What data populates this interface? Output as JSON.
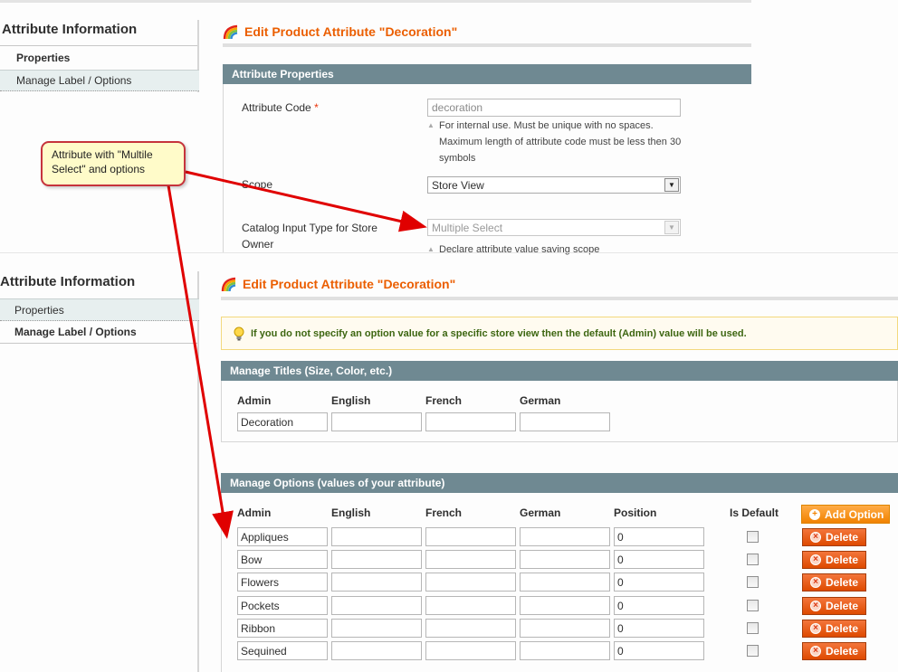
{
  "top_panel": {
    "sidebar": {
      "title": "Attribute Information",
      "items": [
        {
          "label": "Properties",
          "active": true
        },
        {
          "label": "Manage Label / Options",
          "active": false
        }
      ]
    },
    "page_title": "Edit Product Attribute \"Decoration\"",
    "section_title": "Attribute Properties",
    "fields": {
      "attribute_code": {
        "label": "Attribute Code",
        "required_mark": "*",
        "value": "decoration",
        "note_line1": "For internal use. Must be unique with no spaces.",
        "note_line2": "Maximum length of attribute code must be less then 30",
        "note_line3": "symbols"
      },
      "scope": {
        "label": "Scope",
        "value": "Store View",
        "note": "Declare attribute value saving scope"
      },
      "input_type": {
        "label_line1": "Catalog Input Type for Store",
        "label_line2": "Owner",
        "value": "Multiple Select"
      }
    }
  },
  "callout": {
    "line1": "Attribute with \"Multile",
    "line2": "Select\" and options",
    "border_color": "#c6333c",
    "arrow_color": "#e00000"
  },
  "bottom_panel": {
    "sidebar": {
      "title": "Attribute Information",
      "items": [
        {
          "label": "Properties",
          "active": false
        },
        {
          "label": "Manage Label / Options",
          "active": true
        }
      ]
    },
    "page_title": "Edit Product Attribute \"Decoration\"",
    "notice": "If you do not specify an option value for a specific store view then the default (Admin) value will be used.",
    "titles_section": {
      "title": "Manage Titles (Size, Color, etc.)",
      "columns": [
        "Admin",
        "English",
        "French",
        "German"
      ],
      "values": [
        "Decoration",
        "",
        "",
        ""
      ]
    },
    "options_section": {
      "title": "Manage Options (values of your attribute)",
      "columns": [
        "Admin",
        "English",
        "French",
        "German",
        "Position",
        "Is Default"
      ],
      "add_button": "Add Option",
      "delete_button": "Delete",
      "rows": [
        {
          "admin": "Appliques",
          "english": "",
          "french": "",
          "german": "",
          "position": "0",
          "is_default": false
        },
        {
          "admin": "Bow",
          "english": "",
          "french": "",
          "german": "",
          "position": "0",
          "is_default": false
        },
        {
          "admin": "Flowers",
          "english": "",
          "french": "",
          "german": "",
          "position": "0",
          "is_default": false
        },
        {
          "admin": "Pockets",
          "english": "",
          "french": "",
          "german": "",
          "position": "0",
          "is_default": false
        },
        {
          "admin": "Ribbon",
          "english": "",
          "french": "",
          "german": "",
          "position": "0",
          "is_default": false
        },
        {
          "admin": "Sequined",
          "english": "",
          "french": "",
          "german": "",
          "position": "0",
          "is_default": false
        }
      ]
    }
  },
  "colors": {
    "title_orange": "#eb5e00",
    "section_header": "#6f8992",
    "delete_button": "#de4a00",
    "add_button": "#f18200",
    "notice_text": "#3d6611"
  }
}
